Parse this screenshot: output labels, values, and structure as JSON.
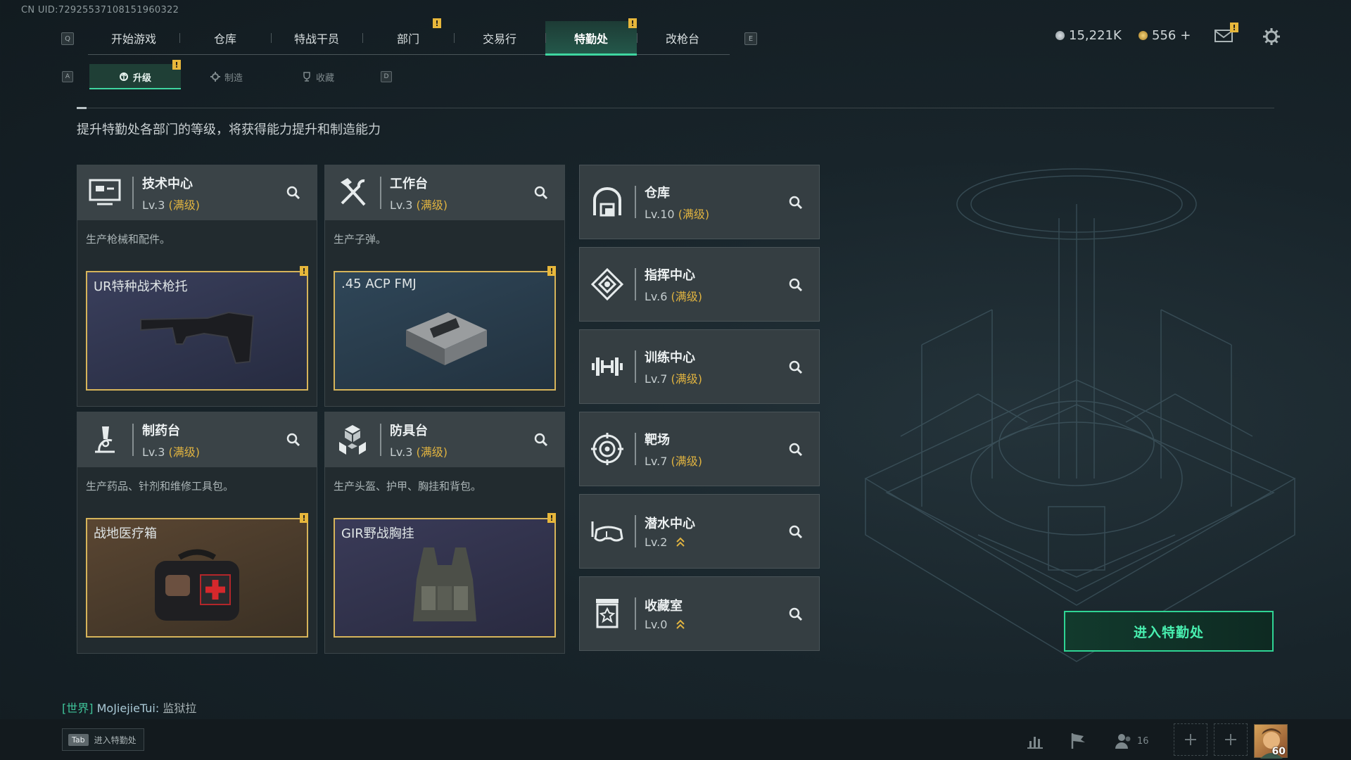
{
  "uid": "CN UID:7292553710815196032​2",
  "topnav": {
    "key_left": "Q",
    "key_right": "E",
    "tabs": [
      {
        "label": "开始游戏",
        "active": false
      },
      {
        "label": "仓库",
        "active": false
      },
      {
        "label": "特战干员",
        "active": false
      },
      {
        "label": "部门",
        "active": false,
        "alert": true
      },
      {
        "label": "交易行",
        "active": false
      },
      {
        "label": "特勤处",
        "active": true,
        "alert": true
      },
      {
        "label": "改枪台",
        "active": false
      }
    ],
    "alert_mark": "!"
  },
  "currency": {
    "silver": "15,221K",
    "gold": "556",
    "gold_plus": "+",
    "mail_alert": "!"
  },
  "subnav": {
    "key_left": "A",
    "key_right": "D",
    "tabs": [
      {
        "label": "升级",
        "active": true,
        "alert": true
      },
      {
        "label": "制造",
        "active": false
      },
      {
        "label": "收藏",
        "active": false
      }
    ]
  },
  "description": "提升特勤处各部门的等级，将获得能力提升和制造能力",
  "max_label": "(满级)",
  "big_cards": [
    {
      "title": "技术中心",
      "level": "Lv.3",
      "max": true,
      "text": "生产枪械和配件。",
      "product": "UR特种战术枪托",
      "product_bg": "#2f3450",
      "icon": "monitor-icon"
    },
    {
      "title": "工作台",
      "level": "Lv.3",
      "max": true,
      "text": "生产子弹。",
      "product": ".45 ACP FMJ",
      "product_bg": "#2a3d4e",
      "icon": "hammer-wrench-icon"
    },
    {
      "title": "制药台",
      "level": "Lv.3",
      "max": true,
      "text": "生产药品、针剂和维修工具包。",
      "product": "战地医疗箱",
      "product_bg": "#4a3d30",
      "icon": "microscope-icon"
    },
    {
      "title": "防具台",
      "level": "Lv.3",
      "max": true,
      "text": "生产头盔、护甲、胸挂和背包。",
      "product": "GIR野战胸挂",
      "product_bg": "#33344d",
      "icon": "cubes-icon"
    }
  ],
  "small_cards": [
    {
      "title": "仓库",
      "level": "Lv.10",
      "max": true,
      "icon": "warehouse-icon"
    },
    {
      "title": "指挥中心",
      "level": "Lv.6",
      "max": true,
      "icon": "command-icon"
    },
    {
      "title": "训练中心",
      "level": "Lv.7",
      "max": true,
      "icon": "dumbbell-icon"
    },
    {
      "title": "靶场",
      "level": "Lv.7",
      "max": true,
      "icon": "target-icon"
    },
    {
      "title": "潜水中心",
      "level": "Lv.2",
      "max": false,
      "icon": "diving-mask-icon"
    },
    {
      "title": "收藏室",
      "level": "Lv.0",
      "max": false,
      "icon": "collection-icon"
    }
  ],
  "enter_button": "进入特勤处",
  "chat": {
    "channel": "[世界]",
    "user": "MoJiejieTui:",
    "message": "监狱拉"
  },
  "bottom": {
    "tab_key": "Tab",
    "tab_label": "进入特勤处",
    "friends_count": "16",
    "avatar_level": "60"
  },
  "colors": {
    "accent": "#3fd6a0",
    "max_gold": "#e0b340",
    "alert": "#e7b73b"
  }
}
